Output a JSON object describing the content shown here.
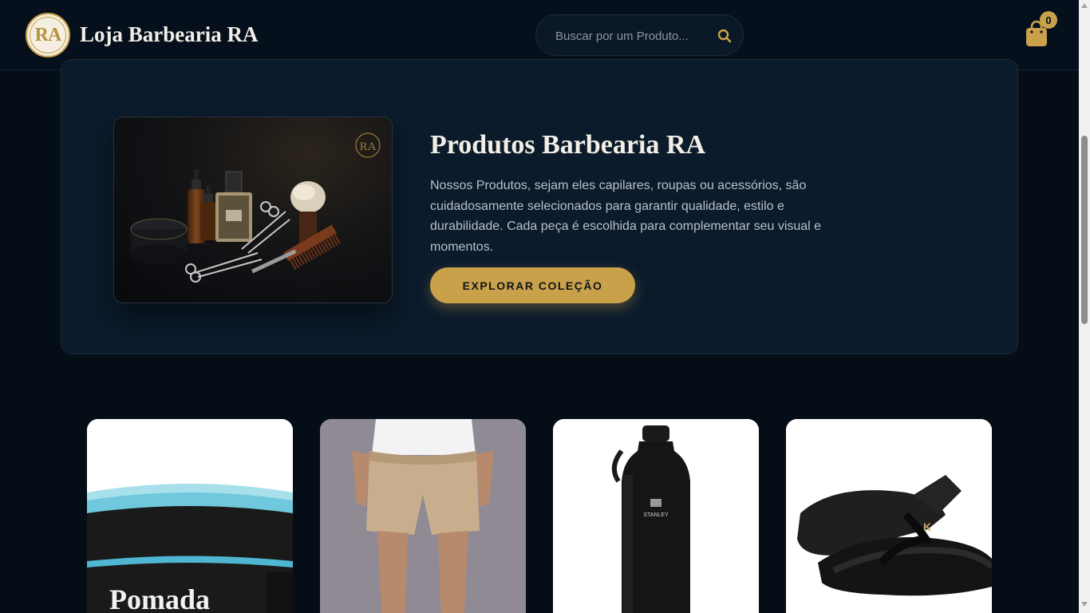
{
  "header": {
    "logo_text": "RA",
    "brand": "Loja Barbearia RA",
    "search_placeholder": "Buscar por um Produto...",
    "cart_count": "0",
    "accent_color": "#c9a14a"
  },
  "hero": {
    "title": "Produtos Barbearia RA",
    "description": "Nossos Produtos, sejam eles capilares, roupas ou acessórios, são cuidadosamente selecionados para garantir qualidade, estilo e durabilidade. Cada peça é escolhida para complementar seu visual e momentos.",
    "button_label": "EXPLORAR COLEÇÃO",
    "image_logo": "RA"
  },
  "products": [
    {
      "image": "pomade-jar",
      "label_text": "Pomada"
    },
    {
      "image": "khaki-shorts"
    },
    {
      "image": "black-bottle",
      "brand_text": "STANLEY"
    },
    {
      "image": "black-flip-flops",
      "logo_text": "K"
    }
  ]
}
